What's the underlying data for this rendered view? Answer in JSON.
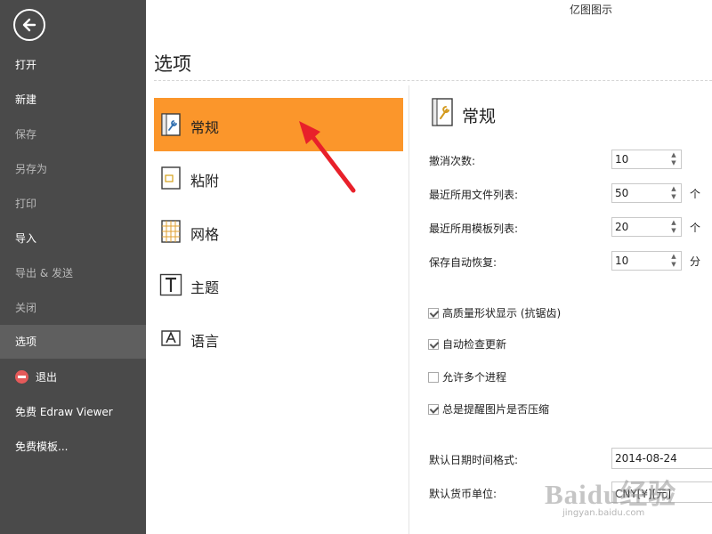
{
  "app_title": "亿图图示",
  "sidebar": {
    "items": [
      {
        "label": "打开",
        "name": "open"
      },
      {
        "label": "新建",
        "name": "new"
      },
      {
        "label": "保存",
        "name": "save"
      },
      {
        "label": "另存为",
        "name": "save-as"
      },
      {
        "label": "打印",
        "name": "print"
      },
      {
        "label": "导入",
        "name": "import"
      },
      {
        "label": "导出 & 发送",
        "name": "export-send"
      },
      {
        "label": "关闭",
        "name": "close"
      },
      {
        "label": "选项",
        "name": "options"
      },
      {
        "label": "退出",
        "name": "exit"
      },
      {
        "label": "免费 Edraw Viewer",
        "name": "free-viewer"
      },
      {
        "label": "免费模板...",
        "name": "free-templates"
      }
    ],
    "active": "选项"
  },
  "page": {
    "title": "选项"
  },
  "categories": [
    {
      "label": "常规",
      "icon": "general-settings-icon",
      "selected": true
    },
    {
      "label": "粘附",
      "icon": "snap-icon",
      "selected": false
    },
    {
      "label": "网格",
      "icon": "grid-icon",
      "selected": false
    },
    {
      "label": "主题",
      "icon": "theme-icon",
      "selected": false
    },
    {
      "label": "语言",
      "icon": "language-icon",
      "selected": false
    }
  ],
  "general": {
    "title": "常规",
    "undo_label": "撤消次数:",
    "undo_value": "10",
    "recent_files_label": "最近所用文件列表:",
    "recent_files_value": "50",
    "recent_files_unit": "个",
    "recent_templates_label": "最近所用模板列表:",
    "recent_templates_value": "20",
    "recent_templates_unit": "个",
    "autosave_label": "保存自动恢复:",
    "autosave_value": "10",
    "autosave_unit": "分",
    "options": [
      {
        "label": "高质量形状显示 (抗锯齿)",
        "checked": true
      },
      {
        "label": "自动检查更新",
        "checked": true
      },
      {
        "label": "允许多个进程",
        "checked": false
      },
      {
        "label": "总是提醒图片是否压缩",
        "checked": true
      }
    ],
    "date_format_label": "默认日期时间格式:",
    "date_format_value": "2014-08-24",
    "currency_label": "默认货币单位:",
    "currency_value": "CNY[¥][元]"
  },
  "watermark": {
    "logo": "Baidu经验",
    "url": "jingyan.baidu.com"
  },
  "colors": {
    "sidebar_bg": "#4a4a4a",
    "selected_category": "#fb962b",
    "annotation_arrow": "#e8202a"
  }
}
